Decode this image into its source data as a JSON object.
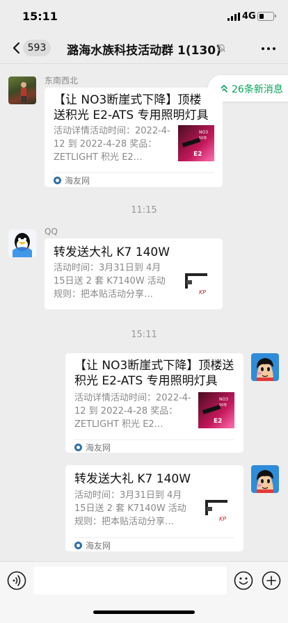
{
  "status": {
    "time": "15:11",
    "network": "4G"
  },
  "nav": {
    "unread_count": "593",
    "title": "潞海水族科技活动群 1(130)"
  },
  "new_messages": "26条新消息",
  "messages": [
    {
      "sender": "东南西北",
      "card": {
        "title": "【让 NO3断崖式下降】顶楼送积光 E2-ATS 专用照明灯具",
        "desc": "活动详情活动时间：2022-4-12 到 2022-4-28 奖品：ZETLIGHT 积光 E2…",
        "source": "海友网",
        "thumb_text": "NO3断崖\n50年震撼\nE2"
      }
    },
    {
      "timestamp": "11:15"
    },
    {
      "sender": "QQ",
      "card": {
        "title": "转发送大礼 K7 140W",
        "desc": "活动时间：3月31日到 4月15日送 2 套 K7140W 活动规则：把本贴活动分享…"
      }
    },
    {
      "timestamp": "15:11"
    },
    {
      "card": {
        "title": "【让 NO3断崖式下降】顶楼送积光 E2-ATS 专用照明灯具",
        "desc": "活动详情活动时间：2022-4-12 到 2022-4-28 奖品：ZETLIGHT 积光 E2…",
        "source": "海友网"
      }
    },
    {
      "card": {
        "title": "转发送大礼 K7 140W",
        "desc": "活动时间：3月31日到 4月15日送 2 套 K7140W 活动规则：把本贴活动分享…",
        "source": "海友网"
      }
    }
  ],
  "colors": {
    "accent_green": "#07a35a",
    "background": "#ededed",
    "card": "#ffffff"
  },
  "icons": {
    "back": "chevron-left",
    "mute": "bell-slash",
    "more": "ellipsis",
    "voice": "voice",
    "emoji": "smile",
    "plus": "plus-circle"
  }
}
